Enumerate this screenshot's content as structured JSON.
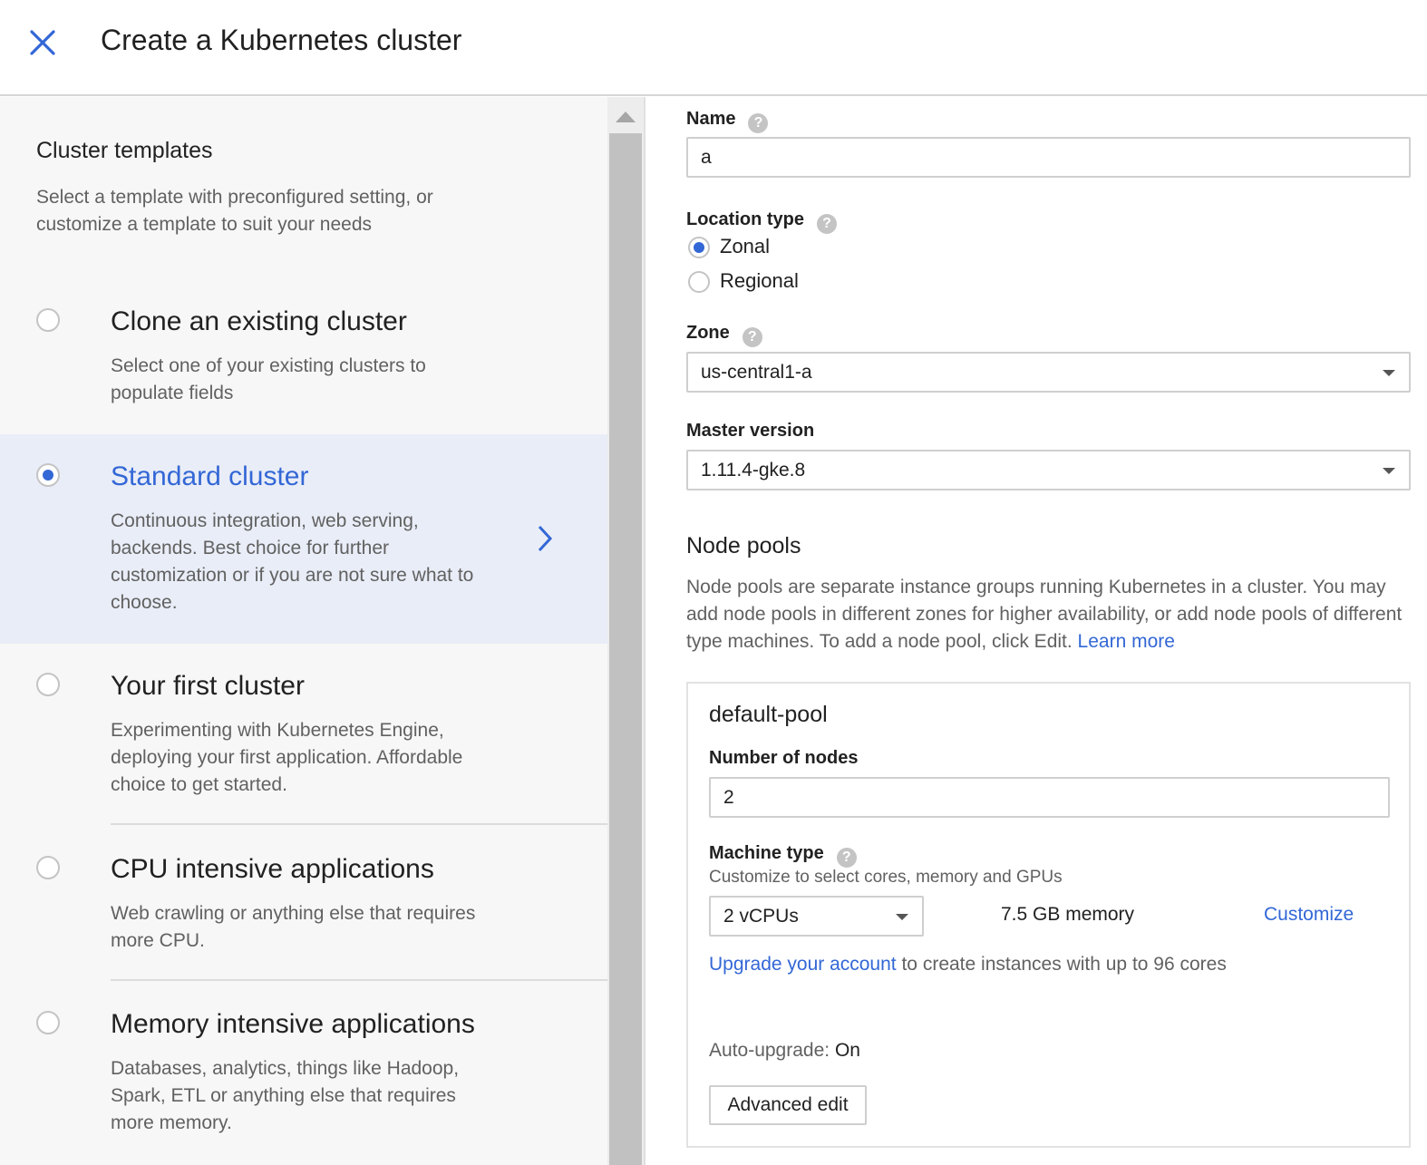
{
  "header": {
    "title": "Create a Kubernetes cluster"
  },
  "templates": {
    "heading": "Cluster templates",
    "description": "Select a template with preconfigured setting, or customize a template to suit your needs",
    "options": [
      {
        "title": "Clone an existing cluster",
        "description": "Select one of your existing clusters to populate fields",
        "selected": false
      },
      {
        "title": "Standard cluster",
        "description": "Continuous integration, web serving, backends. Best choice for further customization or if you are not sure what to choose.",
        "selected": true
      },
      {
        "title": "Your first cluster",
        "description": "Experimenting with Kubernetes Engine, deploying your first application. Affordable choice to get started.",
        "selected": false
      },
      {
        "title": "CPU intensive applications",
        "description": "Web crawling or anything else that requires more CPU.",
        "selected": false
      },
      {
        "title": "Memory intensive applications",
        "description": "Databases, analytics, things like Hadoop, Spark, ETL or anything else that requires more memory.",
        "selected": false
      }
    ]
  },
  "form": {
    "name": {
      "label": "Name",
      "value": "a"
    },
    "location_type": {
      "label": "Location type",
      "options": [
        "Zonal",
        "Regional"
      ],
      "selected": "Zonal"
    },
    "zone": {
      "label": "Zone",
      "value": "us-central1-a"
    },
    "master_version": {
      "label": "Master version",
      "value": "1.11.4-gke.8"
    },
    "node_pools": {
      "heading": "Node pools",
      "description": "Node pools are separate instance groups running Kubernetes in a cluster. You may add node pools in different zones for higher availability, or add node pools of different type machines. To add a node pool, click Edit.",
      "learn_more": "Learn more",
      "pool": {
        "name": "default-pool",
        "nodes_label": "Number of nodes",
        "nodes_value": "2",
        "machine_type_label": "Machine type",
        "machine_type_sub": "Customize to select cores, memory and GPUs",
        "machine_type_value": "2 vCPUs",
        "memory": "7.5 GB memory",
        "customize": "Customize",
        "upgrade_link": "Upgrade your account",
        "upgrade_text": " to create instances with up to 96 cores",
        "auto_upgrade_label": "Auto-upgrade:",
        "auto_upgrade_value": "On",
        "advanced_edit": "Advanced edit"
      }
    }
  },
  "icons": {
    "close": "close-icon",
    "help": "help-icon",
    "chevron": "chevron-right-icon",
    "scroll_up": "scroll-up-arrow-icon",
    "dropdown": "dropdown-caret-icon"
  },
  "colors": {
    "accent": "#3367d6",
    "selected_bg": "#e9edf7",
    "left_bg": "#f7f7f7"
  }
}
